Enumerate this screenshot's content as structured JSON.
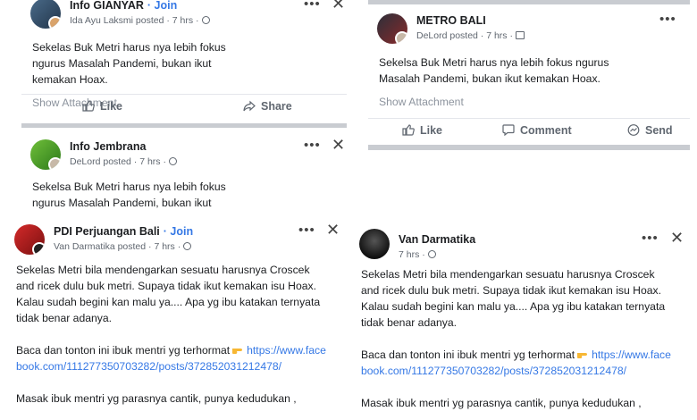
{
  "posts": {
    "gianyar": {
      "page_name": "Info GIANYAR",
      "join_label": "· Join",
      "meta": "Ida Ayu Laksmi posted · 7 hrs ·",
      "text": "Sekelas Buk Metri harus nya lebih fokus ngurus Masalah Pandemi, bukan ikut kemakan Hoax.",
      "attachment": "Show Attachment",
      "like_label": "Like",
      "share_label": "Share"
    },
    "metro_bali": {
      "page_name": "METRO BALI",
      "meta": "DeLord posted · 7 hrs ·",
      "text": "Sekelsa Buk Metri harus nya lebih fokus ngurus Masalah Pandemi, bukan ikut kemakan Hoax.",
      "attachment": "Show Attachment",
      "like_label": "Like",
      "comment_label": "Comment",
      "send_label": "Send"
    },
    "jembrana": {
      "page_name": "Info Jembrana",
      "meta": "DeLord posted · 7 hrs ·",
      "text": "Sekelsa Buk Metri harus nya lebih fokus ngurus Masalah Pandemi, bukan ikut kemakan Hoax."
    },
    "pdi": {
      "page_name": "PDI Perjuangan Bali",
      "join_label": "· Join",
      "meta": "Van Darmatika posted · 7 hrs ·",
      "para1": "Sekelas Metri bila mendengarkan sesuatu harusnya Croscek and ricek dulu buk metri. Supaya tidak ikut kemakan isu Hoax. Kalau sudah begini kan malu ya.... Apa yg ibu katakan ternyata tidak benar adanya.",
      "para2_text": "Baca dan tonton ini ibuk mentri yg terhormat",
      "para2_link": "https://www.facebook.com/111277350703282/posts/372852031212478/",
      "para3": "Masak ibuk mentri yg parasnya cantik, punya kedudukan ,"
    },
    "van": {
      "page_name": "Van Darmatika",
      "meta": "7 hrs ·",
      "para1": "Sekelas Metri bila mendengarkan sesuatu harusnya Croscek and ricek dulu buk metri. Supaya tidak ikut kemakan isu Hoax. Kalau sudah begini kan malu ya.... Apa yg ibu katakan ternyata tidak benar adanya.",
      "para2_text": "Baca dan tonton ini ibuk mentri yg terhormat",
      "para2_link": "https://www.facebook.com/111277350703282/posts/372852031212478/",
      "para3": "Masak ibuk mentri yg parasnya cantik, punya kedudukan ,"
    }
  },
  "icons": {
    "more": "more-options-icon",
    "close": "close-icon",
    "globe": "globe-icon",
    "like": "thumbs-up-icon",
    "share": "share-arrow-icon",
    "comment": "comment-bubble-icon",
    "send": "messenger-icon",
    "emoji": "pointing-hand-emoji"
  },
  "colors": {
    "link": "#3578e5",
    "secondary_text": "#606770",
    "divider": "#c9ccd1"
  }
}
